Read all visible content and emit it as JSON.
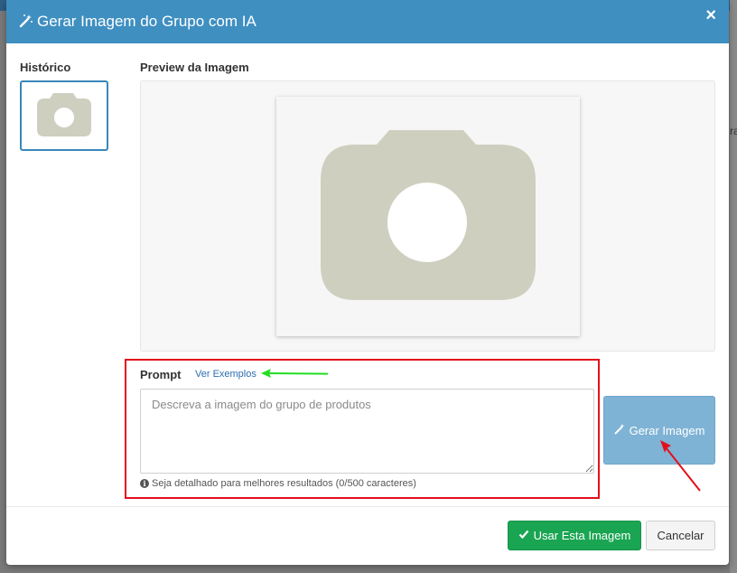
{
  "modal": {
    "title": "Gerar Imagem do Grupo com IA",
    "title_icon": "magic-wand-icon",
    "close_icon": "close-icon",
    "header_color": "#3f8fc1"
  },
  "backdrop": {
    "text_fragment": "ra"
  },
  "history": {
    "label": "Histórico",
    "thumbnail_icon": "camera-icon"
  },
  "preview": {
    "label": "Preview da Imagem",
    "placeholder_icon": "camera-icon",
    "placeholder_color": "#cfcfc0"
  },
  "prompt": {
    "label": "Prompt",
    "examples_link": "Ver Exemplos",
    "placeholder": "Descreva a imagem do grupo de produtos",
    "value": "",
    "hint": "Seja detalhado para melhores resultados (0/500 caracteres)",
    "hint_icon": "info-icon"
  },
  "actions": {
    "generate_label": "Gerar Imagem",
    "generate_icon": "magic-wand-icon",
    "use_label": "Usar Esta Imagem",
    "use_icon": "check-icon",
    "cancel_label": "Cancelar"
  },
  "annotations": {
    "highlight_color": "#e3101b",
    "green_arrow_color": "#22dd22",
    "red_arrow_color": "#e3101b"
  }
}
